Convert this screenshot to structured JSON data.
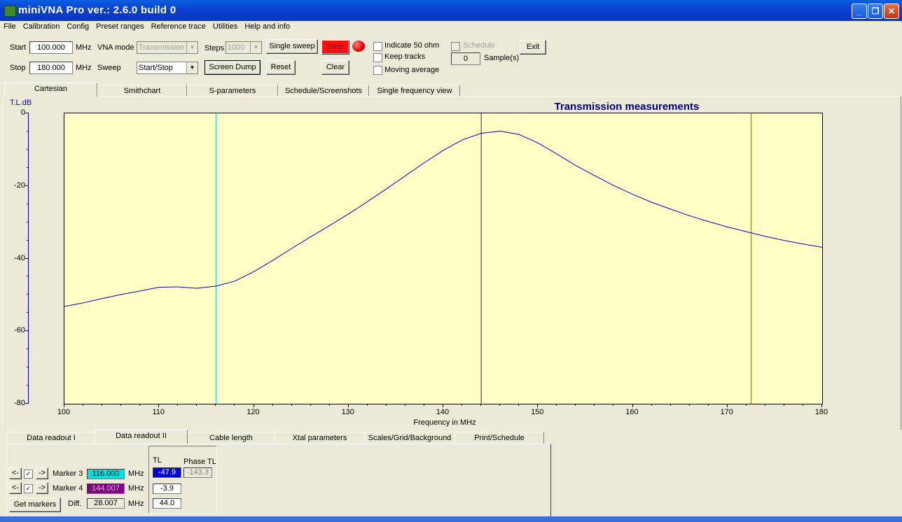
{
  "window": {
    "title": "miniVNA Pro ver.: 2.6.0 build 0"
  },
  "menu": [
    "File",
    "Calibration",
    "Config",
    "Preset ranges",
    "Reference trace",
    "Utilities",
    "Help and info"
  ],
  "controls": {
    "start_label": "Start",
    "start_value": "100.000",
    "start_unit": "MHz",
    "stop_label": "Stop",
    "stop_value": "180.000",
    "stop_unit": "MHz",
    "vna_mode_label": "VNA mode",
    "vna_mode_value": "Transmission",
    "sweep_label": "Sweep",
    "sweep_value": "Start/Stop",
    "steps_label": "Steps",
    "steps_value": "1000",
    "single_sweep": "Single sweep",
    "stop_button": "Stop",
    "screen_dump": "Screen Dump",
    "reset": "Reset",
    "clear": "Clear",
    "indicate_50": "Indicate 50 ohm",
    "keep_tracks": "Keep tracks",
    "moving_average": "Moving average",
    "schedule": "Schedule",
    "samples_value": "0",
    "samples_label": "Sample(s)",
    "exit": "Exit"
  },
  "tabs": [
    "Cartesian",
    "Smithchart",
    "S-parameters",
    "Schedule/Screenshots",
    "Single frequency view"
  ],
  "bottom_tabs": [
    "Data readout I",
    "Data readout II",
    "Cable length",
    "Xtal parameters",
    "Scales/Grid/Background",
    "Print/Schedule"
  ],
  "readout": {
    "marker3_label": "Marker 3",
    "marker3_freq": "116.000",
    "marker3_tl": "-47.9",
    "marker3_phase": "-143.3",
    "marker4_label": "Marker 4",
    "marker4_freq": "144.007",
    "marker4_tl": "-3.9",
    "unit": "MHz",
    "diff_label": "Diff.",
    "diff_freq": "28.007",
    "diff_tl": "44.0",
    "tl_header": "TL",
    "phase_header": "Phase TL",
    "get_markers": "Get markers",
    "left_arrow": "<-",
    "right_arrow": "->"
  },
  "colors": {
    "plot_bg": "#ffffc6",
    "trace": "#0000cc",
    "marker3": "#00cccc",
    "marker4": "#660066",
    "marker_extra": "#996600",
    "title": "#000080",
    "stop_btn": "#ff0000"
  },
  "chart_data": {
    "type": "line",
    "title": "Transmission measurements",
    "xlabel": "Frequency in MHz",
    "ylabel": "T.L.dB",
    "xlim": [
      100,
      180
    ],
    "ylim": [
      -80,
      0
    ],
    "xticks": [
      "100",
      "110",
      "120",
      "130",
      "140",
      "150",
      "160",
      "170",
      "180"
    ],
    "yticks": [
      "0",
      "-20",
      "-40",
      "-60",
      "-80"
    ],
    "markers_x": [
      116.0,
      144.007,
      172.5
    ],
    "series": [
      {
        "x": [
          100,
          102,
          104,
          106,
          108,
          110,
          112,
          114,
          116,
          118,
          120,
          122,
          124,
          126,
          128,
          130,
          132,
          134,
          136,
          138,
          140,
          142,
          144,
          146,
          148,
          150,
          152,
          154,
          156,
          158,
          160,
          162,
          164,
          166,
          168,
          170,
          172,
          174,
          176,
          178,
          180
        ],
        "y": [
          -53.2,
          -52.2,
          -51.0,
          -49.9,
          -48.9,
          -47.9,
          -47.8,
          -48.2,
          -47.6,
          -46.2,
          -43.6,
          -40.5,
          -37.2,
          -34.0,
          -30.9,
          -27.7,
          -24.3,
          -20.8,
          -17.2,
          -13.6,
          -10.2,
          -7.3,
          -5.5,
          -4.9,
          -5.8,
          -8.2,
          -11.2,
          -14.4,
          -17.2,
          -19.9,
          -22.3,
          -24.5,
          -26.4,
          -28.2,
          -29.8,
          -31.3,
          -32.6,
          -33.9,
          -35.0,
          -36.0,
          -36.9
        ]
      }
    ]
  }
}
